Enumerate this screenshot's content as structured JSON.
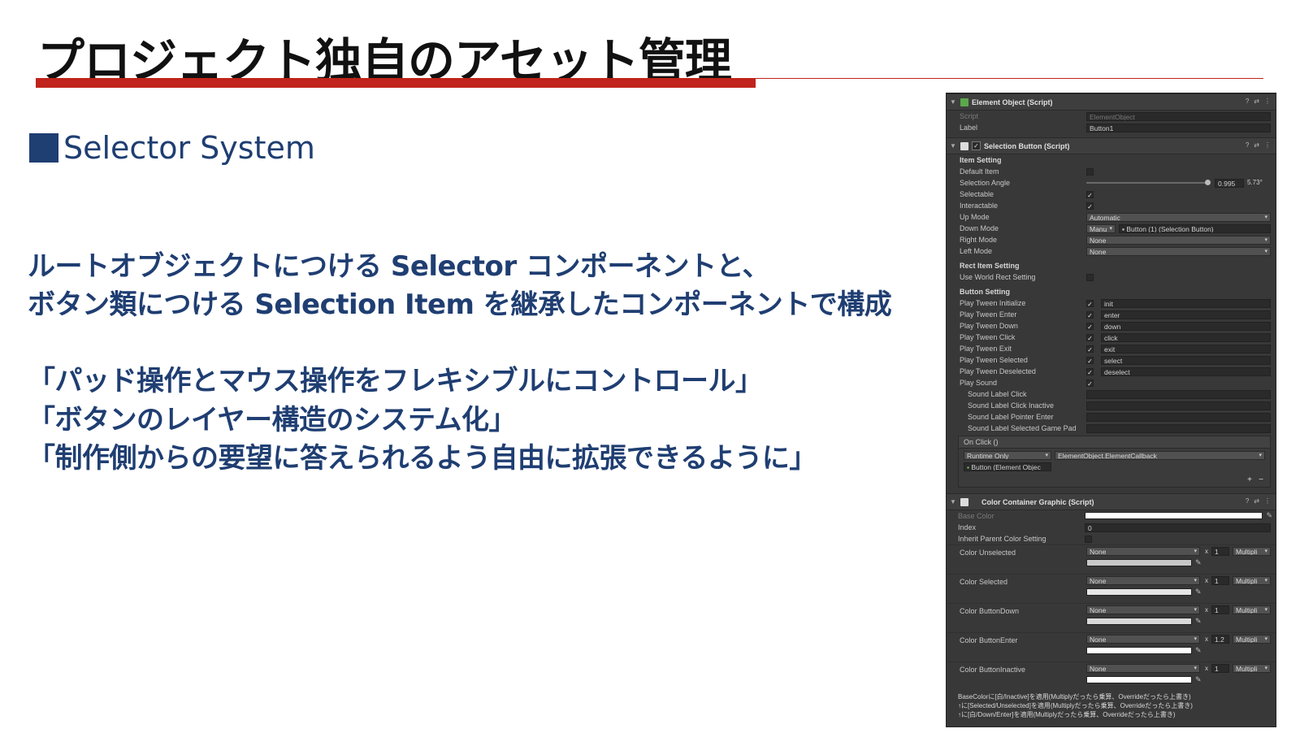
{
  "slide": {
    "title": "プロジェクト独自のアセット管理",
    "section": "Selector System",
    "line1": "ルートオブジェクトにつける Selector コンポーネントと、",
    "line2": "ボタン類につける Selection Item を継承したコンポーネントで構成",
    "line3": "「パッド操作とマウス操作をフレキシブルにコントロール」",
    "line4": "「ボタンのレイヤー構造のシステム化」",
    "line5": "「制作側からの要望に答えられるよう自由に拡張できるように」",
    "accent": "#1f3e72",
    "bar_color": "#c0241c"
  },
  "inspector": {
    "element_object": {
      "header": "Element Object (Script)",
      "script_label": "Script",
      "script_value": "ElementObject",
      "label_label": "Label",
      "label_value": "Button1"
    },
    "selection_button": {
      "header": "Selection Button (Script)",
      "item_setting": "Item Setting",
      "default_item": "Default Item",
      "selection_angle": "Selection Angle",
      "selection_angle_value": "0.995",
      "selection_angle_deg": "5.73°",
      "selectable": "Selectable",
      "interactable": "Interactable",
      "up_mode": "Up Mode",
      "up_mode_value": "Automatic",
      "down_mode": "Down Mode",
      "down_mode_value": "Manu",
      "down_mode_target": "Button (1) (Selection Button)",
      "right_mode": "Right Mode",
      "right_mode_value": "None",
      "left_mode": "Left Mode",
      "left_mode_value": "None",
      "rect_item_setting": "Rect Item Setting",
      "use_world_rect": "Use World Rect Setting",
      "button_setting": "Button Setting",
      "tweens": [
        {
          "label": "Play Tween Initialize",
          "value": "init"
        },
        {
          "label": "Play Tween Enter",
          "value": "enter"
        },
        {
          "label": "Play Tween Down",
          "value": "down"
        },
        {
          "label": "Play Tween Click",
          "value": "click"
        },
        {
          "label": "Play Tween Exit",
          "value": "exit"
        },
        {
          "label": "Play Tween Selected",
          "value": "select"
        },
        {
          "label": "Play Tween Deselected",
          "value": "deselect"
        }
      ],
      "play_sound": "Play Sound",
      "sounds": [
        "Sound Label Click",
        "Sound Label Click Inactive",
        "Sound Label Pointer Enter",
        "Sound Label Selected Game Pad"
      ],
      "on_click": "On Click ()",
      "runtime": "Runtime Only",
      "callback": "ElementObject.ElementCallback",
      "callback_target": "Button (Element Objec",
      "plus": "+",
      "minus": "−"
    },
    "color_container": {
      "header": "Color Container Graphic (Script)",
      "base_color": "Base Color",
      "index": "Index",
      "index_value": "0",
      "inherit": "Inherit Parent Color Setting",
      "colors": [
        {
          "label": "Color Unselected",
          "mode": "None",
          "x": "x",
          "mult": "1",
          "blend": "Multipli"
        },
        {
          "label": "Color Selected",
          "mode": "None",
          "x": "x",
          "mult": "1",
          "blend": "Multipli"
        },
        {
          "label": "Color ButtonDown",
          "mode": "None",
          "x": "x",
          "mult": "1",
          "blend": "Multipli"
        },
        {
          "label": "Color ButtonEnter",
          "mode": "None",
          "x": "x",
          "mult": "1.2",
          "blend": "Multipli"
        },
        {
          "label": "Color ButtonInactive",
          "mode": "None",
          "x": "x",
          "mult": "1",
          "blend": "Multipli"
        }
      ],
      "notes": [
        "BaseColorに[白/Inactive]を適用(Multiplyだったら乗算、Overrideだったら上書き)",
        "↑に[Selected/Unselected]を適用(Multiplyだったら乗算、Overrideだったら上書き)",
        "↑に[白/Down/Enter]を適用(Multiplyだったら乗算、Overrideだったら上書き)"
      ]
    }
  }
}
